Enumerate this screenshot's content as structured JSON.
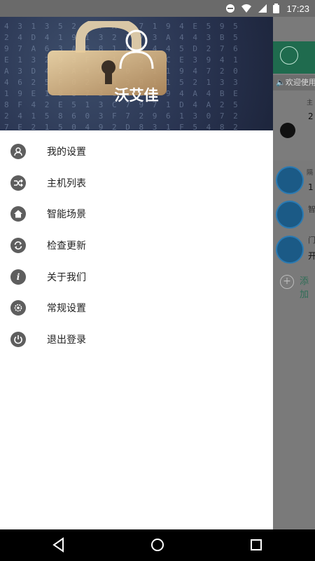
{
  "status_bar": {
    "time": "17:23"
  },
  "drawer": {
    "username": "沃艾佳",
    "menu": [
      {
        "label": "我的设置",
        "icon": "user-icon"
      },
      {
        "label": "主机列表",
        "icon": "shuffle-icon"
      },
      {
        "label": "智能场景",
        "icon": "home-icon"
      },
      {
        "label": "检查更新",
        "icon": "refresh-icon"
      },
      {
        "label": "关于我们",
        "icon": "info-icon"
      },
      {
        "label": "常规设置",
        "icon": "settings-icon"
      },
      {
        "label": "退出登录",
        "icon": "power-icon"
      }
    ]
  },
  "background_app": {
    "welcome_text": "欢迎使用",
    "row1_value": "2",
    "row2_value": "1",
    "row3_label": "智",
    "row4_label": "门",
    "row4_value": "开",
    "add_text": "添加",
    "small_label_1": "主",
    "small_label_2": "隔"
  },
  "colors": {
    "background_app_header": "#1f6b4e",
    "drawer_bg": "#ffffff",
    "menu_icon_bg": "#5e5e5e"
  }
}
